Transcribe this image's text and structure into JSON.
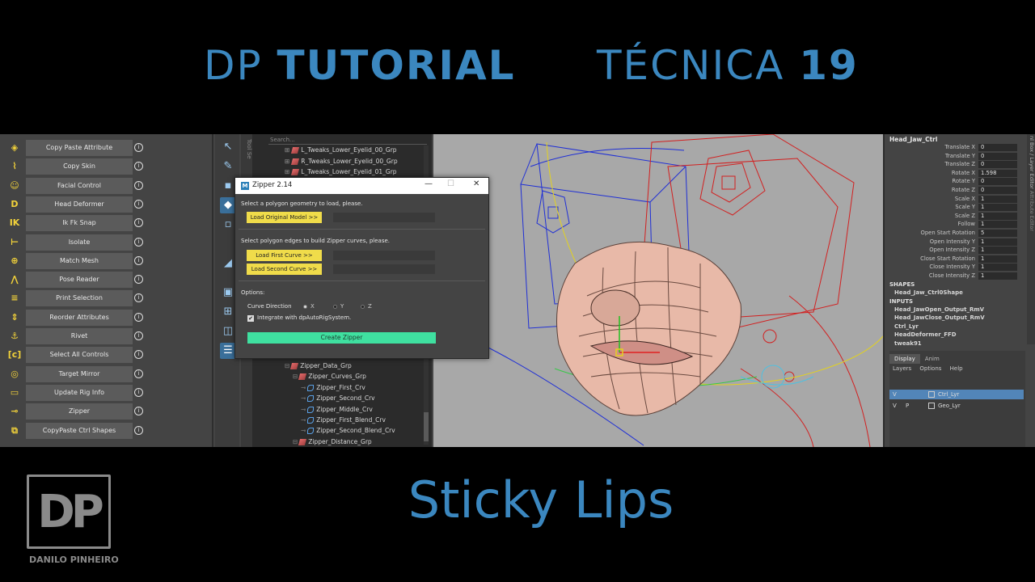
{
  "header": {
    "left_light": "DP ",
    "left_bold": "TUTORIAL",
    "right_light": "TÉCNICA ",
    "right_bold": "19"
  },
  "subtitle": "Sticky Lips",
  "logo": {
    "mark": "DP",
    "caption": "DANILO PINHEIRO"
  },
  "tools": [
    {
      "icon": "attr-icon",
      "glyph": "◈",
      "label": "Copy Paste Attribute"
    },
    {
      "icon": "copy-skin-icon",
      "glyph": "⌇",
      "label": "Copy Skin"
    },
    {
      "icon": "face-icon",
      "glyph": "☺",
      "label": "Facial Control"
    },
    {
      "icon": "head-deformer-icon",
      "glyph": "D",
      "label": "Head Deformer"
    },
    {
      "icon": "ik-fk-icon",
      "glyph": "IK",
      "label": "Ik Fk Snap"
    },
    {
      "icon": "isolate-icon",
      "glyph": "⊢",
      "label": "Isolate"
    },
    {
      "icon": "match-mesh-icon",
      "glyph": "⊕",
      "label": "Match Mesh"
    },
    {
      "icon": "pose-reader-icon",
      "glyph": "⋀",
      "label": "Pose Reader"
    },
    {
      "icon": "print-selection-icon",
      "glyph": "≡",
      "label": "Print Selection"
    },
    {
      "icon": "reorder-icon",
      "glyph": "⇕",
      "label": "Reorder Attributes"
    },
    {
      "icon": "rivet-icon",
      "glyph": "⚓",
      "label": "Rivet"
    },
    {
      "icon": "ctrl-icon",
      "glyph": "[c]",
      "label": "Select All Controls"
    },
    {
      "icon": "target-mirror-icon",
      "glyph": "◎",
      "label": "Target Mirror"
    },
    {
      "icon": "update-rig-icon",
      "glyph": "▭",
      "label": "Update Rig Info"
    },
    {
      "icon": "zipper-icon",
      "glyph": "⊸",
      "label": "Zipper"
    },
    {
      "icon": "copy-shapes-icon",
      "glyph": "⧉",
      "label": "CopyPaste Ctrl Shapes"
    }
  ],
  "outliner": {
    "tab_label": "Tool Se",
    "search_placeholder": "Search...",
    "top_items": [
      "L_Tweaks_Lower_Eyelid_00_Grp",
      "R_Tweaks_Lower_Eyelid_00_Grp",
      "L_Tweaks_Lower_Eyelid_01_Grp"
    ],
    "bottom_items": [
      {
        "label": "Zipper_Data_Grp",
        "type": "grp",
        "indent": 0
      },
      {
        "label": "Zipper_Curves_Grp",
        "type": "grp",
        "indent": 1
      },
      {
        "label": "Zipper_First_Crv",
        "type": "crv",
        "indent": 2
      },
      {
        "label": "Zipper_Second_Crv",
        "type": "crv",
        "indent": 2
      },
      {
        "label": "Zipper_Middle_Crv",
        "type": "crv",
        "indent": 2
      },
      {
        "label": "Zipper_First_Blend_Crv",
        "type": "crv",
        "indent": 2
      },
      {
        "label": "Zipper_Second_Blend_Crv",
        "type": "crv",
        "indent": 2
      },
      {
        "label": "Zipper_Distance_Grp",
        "type": "grp",
        "indent": 1
      }
    ]
  },
  "dialog": {
    "title": "Zipper 2.14",
    "minimize": "—",
    "maximize": "☐",
    "close": "✕",
    "step1": "Select a polygon geometry to load, please.",
    "load_model": "Load Original Model >>",
    "step2": "Select polygon edges to build Zipper curves, please.",
    "load_first": "Load First Curve >>",
    "load_second": "Load Second Curve >>",
    "options": "Options:",
    "curve_direction": "Curve Direction",
    "dir_x": "X",
    "dir_y": "Y",
    "dir_z": "Z",
    "integrate": "Integrate with dpAutoRigSystem.",
    "create": "Create Zipper"
  },
  "channelbox": {
    "node": "Head_Jaw_Ctrl",
    "attrs": [
      {
        "label": "Translate X",
        "value": "0"
      },
      {
        "label": "Translate Y",
        "value": "0"
      },
      {
        "label": "Translate Z",
        "value": "0"
      },
      {
        "label": "Rotate X",
        "value": "1.598"
      },
      {
        "label": "Rotate Y",
        "value": "0"
      },
      {
        "label": "Rotate Z",
        "value": "0"
      },
      {
        "label": "Scale X",
        "value": "1"
      },
      {
        "label": "Scale Y",
        "value": "1"
      },
      {
        "label": "Scale Z",
        "value": "1"
      },
      {
        "label": "Follow",
        "value": "1"
      },
      {
        "label": "Open Start Rotation",
        "value": "5"
      },
      {
        "label": "Open Intensity Y",
        "value": "1"
      },
      {
        "label": "Open Intensity Z",
        "value": "1"
      },
      {
        "label": "Close Start Rotation",
        "value": "1"
      },
      {
        "label": "Close Intensity Y",
        "value": "1"
      },
      {
        "label": "Close Intensity Z",
        "value": "1"
      }
    ],
    "shapes_header": "SHAPES",
    "shape": "Head_Jaw_Ctrl0Shape",
    "inputs_header": "INPUTS",
    "inputs": [
      "Head_JawOpen_Output_RmV",
      "Head_JawClose_Output_RmV",
      "Ctrl_Lyr",
      "HeadDeformer_FFD",
      "tweak91"
    ],
    "side_tabs": [
      "nl Box / Layer Editor",
      "Attribute Editor"
    ]
  },
  "layers": {
    "tabs": [
      "Display",
      "Anim"
    ],
    "menu": [
      "Layers",
      "Options",
      "Help"
    ],
    "items": [
      {
        "v": "V",
        "p": "",
        "name": "Ctrl_Lyr",
        "selected": true
      },
      {
        "v": "V",
        "p": "P",
        "name": "Geo_Lyr",
        "selected": false
      }
    ]
  },
  "colors": {
    "accent": "#3b87bf",
    "button_yellow": "#f0dc4a",
    "button_green": "#3fe0a0",
    "layer_select": "#5285b8"
  }
}
